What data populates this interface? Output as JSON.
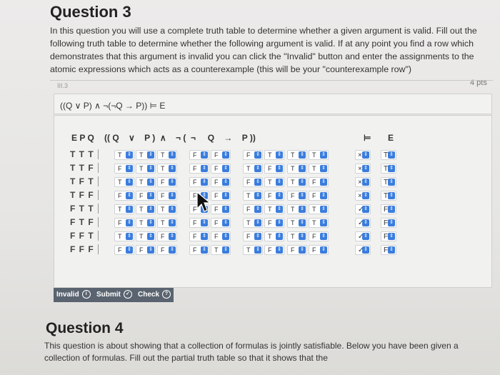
{
  "question3": {
    "title": "Question 3",
    "intro": "In this question you will use a complete truth table to determine whether a given argument is valid. Fill out the following truth table to determine whether the following argument is valid. If at any point you find a row which demonstrates that this argument is invalid you can click the \"Invalid\" button and enter the assignments to the atomic expressions which acts as a counterexample (this will be your \"counterexample row\")",
    "points": "4 pts",
    "qid": "III.3",
    "argument": "((Q ∨ P) ∧ ¬(¬Q → P)) ⊨ E",
    "header": {
      "vars": "E P Q",
      "formula": "(( Q    ∨    P )  ∧    ¬ (  ¬     Q    →    P ))",
      "entails": "⊨",
      "conclusion": "E"
    },
    "rows": [
      {
        "label": "T T T",
        "cells": [
          "T",
          "T",
          "T",
          "F",
          "F",
          "F",
          "T",
          "T",
          "T"
        ],
        "mark": "×",
        "concl": "T"
      },
      {
        "label": "T T F",
        "cells": [
          "F",
          "T",
          "T",
          "F",
          "F",
          "T",
          "F",
          "T",
          "T"
        ],
        "mark": "×",
        "concl": "T"
      },
      {
        "label": "T F T",
        "cells": [
          "T",
          "T",
          "F",
          "F",
          "F",
          "F",
          "T",
          "T",
          "F"
        ],
        "mark": "×",
        "concl": "T"
      },
      {
        "label": "T F F",
        "cells": [
          "F",
          "F",
          "F",
          "F",
          "F",
          "T",
          "F",
          "F",
          "F"
        ],
        "mark": "×",
        "concl": "T"
      },
      {
        "label": "F T T",
        "cells": [
          "T",
          "T",
          "T",
          "F",
          "F",
          "F",
          "T",
          "T",
          "T"
        ],
        "mark": "✓",
        "concl": "F"
      },
      {
        "label": "F T F",
        "cells": [
          "F",
          "T",
          "T",
          "F",
          "F",
          "T",
          "F",
          "T",
          "T"
        ],
        "mark": "✓",
        "concl": "F"
      },
      {
        "label": "F F T",
        "cells": [
          "T",
          "T",
          "F",
          "F",
          "F",
          "F",
          "T",
          "T",
          "F"
        ],
        "mark": "✓",
        "concl": "F"
      },
      {
        "label": "F F F",
        "cells": [
          "F",
          "F",
          "F",
          "F",
          "T",
          "T",
          "F",
          "F",
          "F"
        ],
        "mark": "✓",
        "concl": "F"
      }
    ],
    "buttons": {
      "invalid": "Invalid",
      "submit": "Submit",
      "check": "Check"
    }
  },
  "question4": {
    "title": "Question 4",
    "text": "This question is about showing that a collection of formulas is jointly satisfiable. Below you have been given a collection of formulas. Fill out the partial truth table so that it shows that the"
  }
}
